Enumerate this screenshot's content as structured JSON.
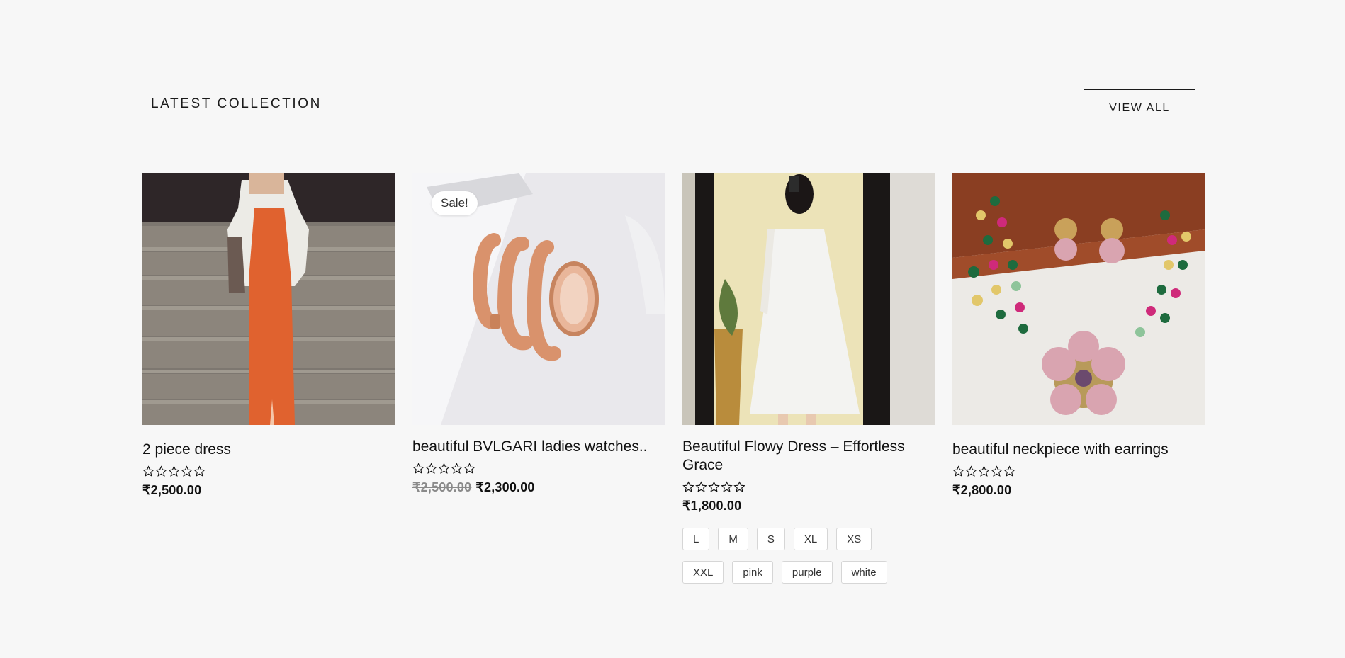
{
  "section": {
    "title": "LATEST COLLECTION",
    "view_all_label": "VIEW ALL"
  },
  "products": [
    {
      "title": "2 piece dress",
      "rating": 0,
      "price": "₹2,500.00",
      "image": "woman-orange-dress-white-shirt"
    },
    {
      "title": "beautiful BVLGARI ladies watches..",
      "badge": "Sale!",
      "rating": 0,
      "old_price": "₹2,500.00",
      "price": "₹2,300.00",
      "image": "rose-gold-serpent-watch"
    },
    {
      "title": "Beautiful Flowy Dress – Effortless Grace",
      "rating": 0,
      "price": "₹1,800.00",
      "image": "white-flowy-dress-mirror-selfie",
      "sizes": [
        "L",
        "M",
        "S",
        "XL",
        "XS",
        "XXL"
      ],
      "colors": [
        "pink",
        "purple",
        "white"
      ]
    },
    {
      "title": "beautiful neckpiece with earrings",
      "rating": 0,
      "price": "₹2,800.00",
      "image": "beaded-necklace-pink-stones"
    }
  ],
  "icons": {
    "star": "star-outline-icon"
  },
  "colors": {
    "background": "#f7f7f7",
    "text": "#111111",
    "muted_price": "#8a8a8a"
  }
}
